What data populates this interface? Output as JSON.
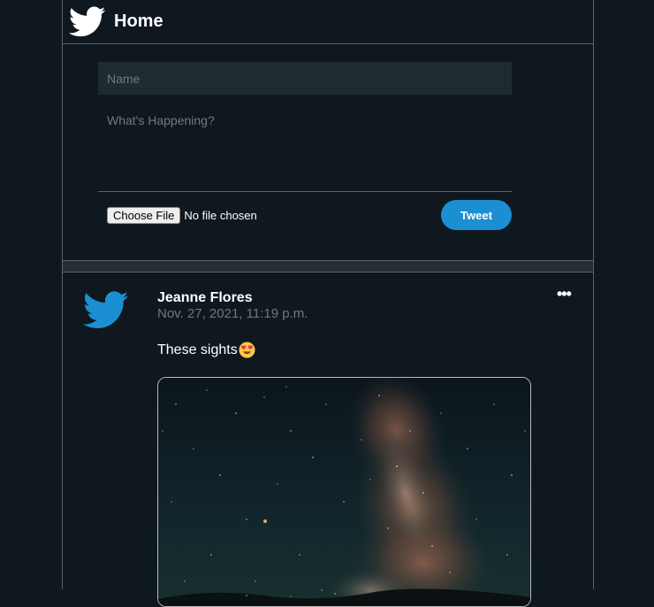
{
  "header": {
    "title": "Home",
    "logo_icon": "twitter-bird-icon"
  },
  "compose": {
    "name_placeholder": "Name",
    "name_value": "",
    "text_placeholder": "What's Happening?",
    "text_value": "",
    "choose_file_label": "Choose File",
    "file_status": "No file chosen",
    "tweet_label": "Tweet"
  },
  "posts": [
    {
      "author": "Jeanne Flores",
      "timestamp": "Nov. 27, 2021, 11:19 p.m.",
      "text": "These sights",
      "emoji_icon": "heart-eyes-emoji-icon",
      "avatar_icon": "twitter-bird-icon",
      "menu_icon": "more-options-icon",
      "image_icon": "night-sky-milky-way-image"
    }
  ],
  "colors": {
    "background": "#0f181f",
    "accent": "#1c8fd3",
    "border": "#5b6268",
    "muted_text": "#6e7880",
    "input_bg": "#202a31"
  }
}
